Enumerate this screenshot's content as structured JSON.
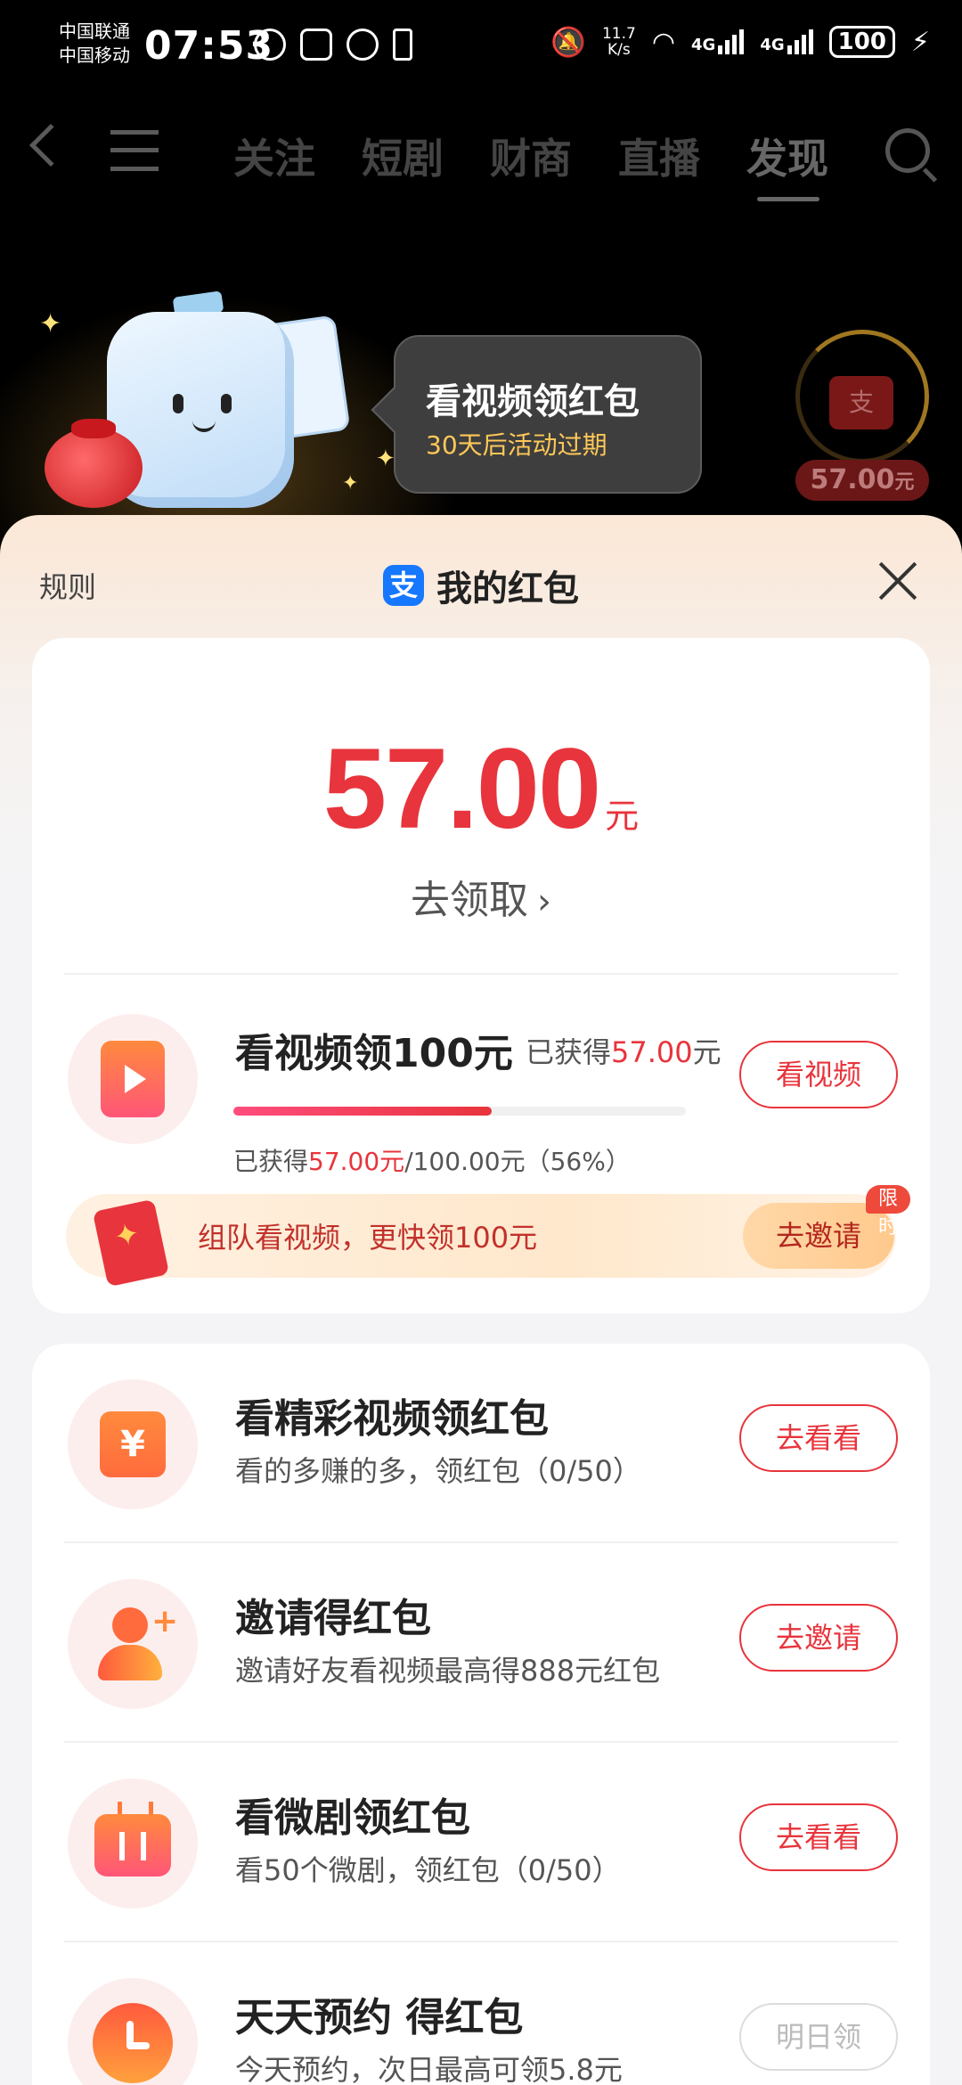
{
  "status_bar": {
    "carrier_1": "中国联通",
    "carrier_2": "中国移动",
    "time": "07:53",
    "net_speed_value": "11.7",
    "net_speed_unit": "K/s",
    "signal_1": "4G",
    "signal_2": "4G",
    "battery": "100"
  },
  "top_nav": {
    "tabs": [
      {
        "label": "关注",
        "active": false
      },
      {
        "label": "短剧",
        "active": false
      },
      {
        "label": "财商",
        "active": false
      },
      {
        "label": "直播",
        "active": false
      },
      {
        "label": "发现",
        "active": true
      }
    ]
  },
  "promo_bubble": {
    "title": "看视频领红包",
    "subtitle": "30天后活动过期"
  },
  "floating_red_packet": {
    "amount": "57.00",
    "unit": "元",
    "glyph": "支"
  },
  "sheet": {
    "rules_label": "规则",
    "title": "我的红包",
    "alipay_glyph": "支"
  },
  "balance": {
    "amount": "57.00",
    "unit": "元",
    "claim_label": "去领取",
    "claim_arrow": "›"
  },
  "video_task": {
    "title": "看视频领100元",
    "earned_prefix": "已获得",
    "earned_amount": "57.00",
    "earned_suffix": "元",
    "progress_prefix": "已获得",
    "progress_amount": "57.00元",
    "progress_total": "/100.00元（56%）",
    "progress_fraction": 0.57,
    "button": "看视频"
  },
  "invite_bar": {
    "text": "组队看视频，更快领100元",
    "button": "去邀请",
    "tag": "限时"
  },
  "tasks": [
    {
      "title": "看精彩视频领红包",
      "subtitle": "看的多赚的多，领红包（0/50）",
      "button": "去看看",
      "enabled": true,
      "icon": "yen-icon",
      "icon_glyph": "¥"
    },
    {
      "title": "邀请得红包",
      "subtitle": "邀请好友看视频最高得888元红包",
      "button": "去邀请",
      "enabled": true,
      "icon": "add-user-icon",
      "icon_glyph": "+"
    },
    {
      "title": "看微剧领红包",
      "subtitle": "看50个微剧，领红包（0/50）",
      "button": "去看看",
      "enabled": true,
      "icon": "tv-icon"
    },
    {
      "title": "天天预约 得红包",
      "subtitle": "今天预约，次日最高可领5.8元",
      "button": "明日领",
      "enabled": false,
      "icon": "clock-icon"
    }
  ],
  "colors": {
    "accent_red": "#e8343c",
    "alipay_blue": "#1677ff",
    "bubble_text_gold": "#ffc857"
  }
}
